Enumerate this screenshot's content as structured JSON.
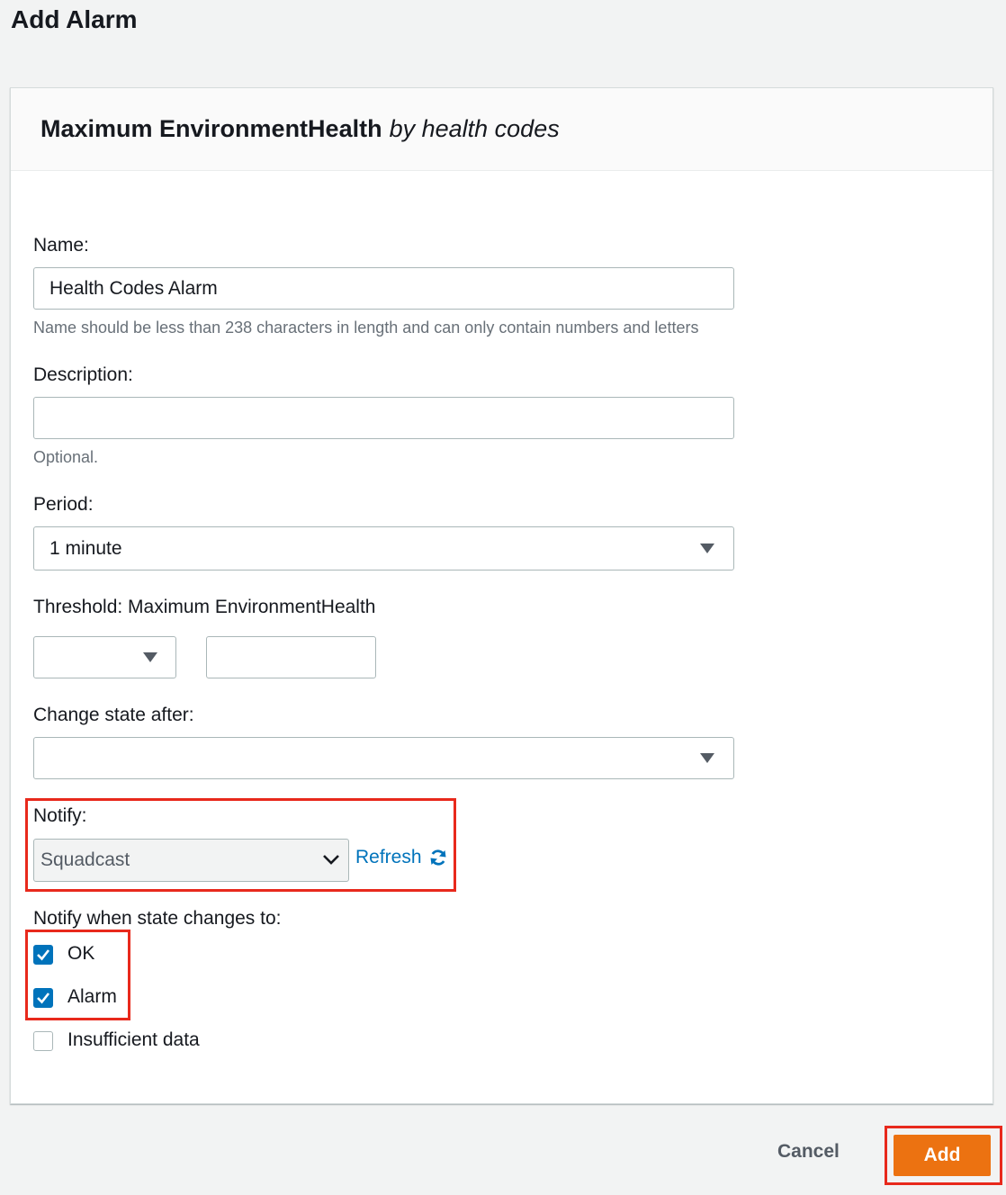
{
  "page_title": "Add Alarm",
  "panel": {
    "title_strong": "Maximum EnvironmentHealth",
    "title_em": "by health codes"
  },
  "form": {
    "name_label": "Name:",
    "name_value": "Health Codes Alarm",
    "name_hint": "Name should be less than 238 characters in length and can only contain numbers and letters",
    "description_label": "Description:",
    "description_value": "",
    "description_hint": "Optional.",
    "period_label": "Period:",
    "period_value": "1 minute",
    "threshold_label": "Threshold: Maximum EnvironmentHealth",
    "threshold_operator_value": "",
    "threshold_value": "",
    "change_state_label": "Change state after:",
    "change_state_value": "",
    "notify_label": "Notify:",
    "notify_value": "Squadcast",
    "refresh_label": "Refresh",
    "notify_when_label": "Notify when state changes to:",
    "states": [
      {
        "label": "OK",
        "checked": true
      },
      {
        "label": "Alarm",
        "checked": true
      },
      {
        "label": "Insufficient data",
        "checked": false
      }
    ]
  },
  "footer": {
    "cancel_label": "Cancel",
    "add_label": "Add"
  },
  "colors": {
    "accent_blue": "#0073bb",
    "primary_orange": "#ec7211",
    "highlight_red": "#e8291c"
  }
}
